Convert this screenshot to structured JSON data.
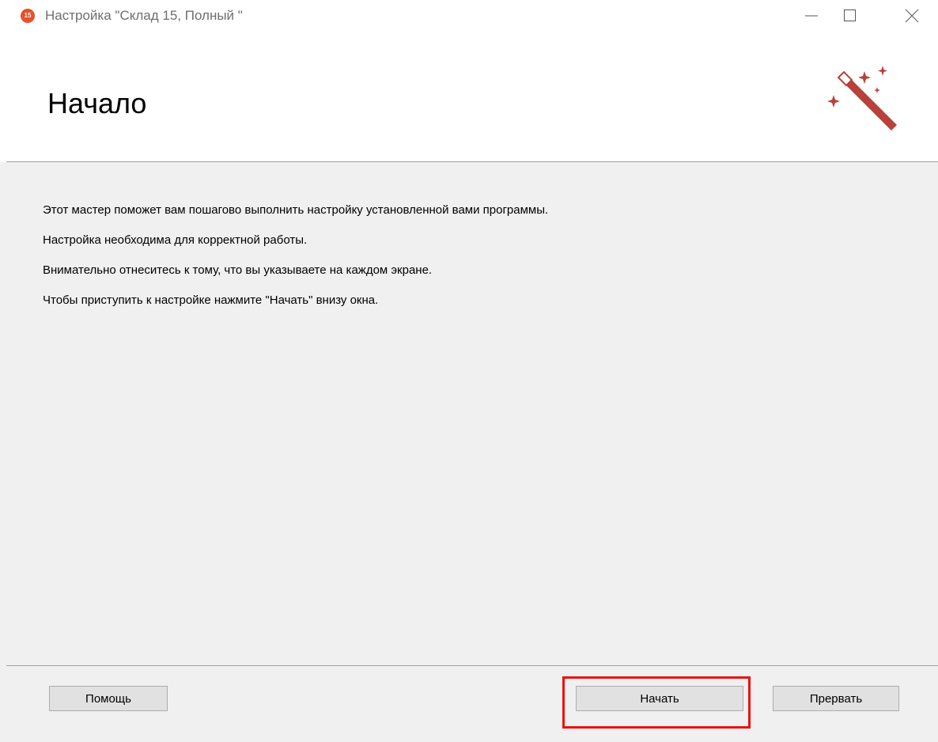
{
  "window": {
    "title": "Настройка \"Склад 15, Полный \"",
    "app_icon_text": "15",
    "controls": [
      "minimize",
      "maximize",
      "close"
    ]
  },
  "header": {
    "title": "Начало",
    "icon": "magic-wand-icon"
  },
  "content": {
    "lines": [
      "Этот мастер поможет вам пошагово выполнить настройку установленной вами программы.",
      "Настройка необходима для корректной работы.",
      "Внимательно отнеситесь к тому, что вы указываете на каждом экране.",
      "Чтобы приступить к настройке нажмите \"Начать\" внизу окна."
    ]
  },
  "footer": {
    "help_label": "Помощь",
    "start_label": "Начать",
    "abort_label": "Прервать"
  },
  "colors": {
    "accent": "#b8413a",
    "highlight": "#ee1111",
    "app_icon": "#e8502a"
  }
}
